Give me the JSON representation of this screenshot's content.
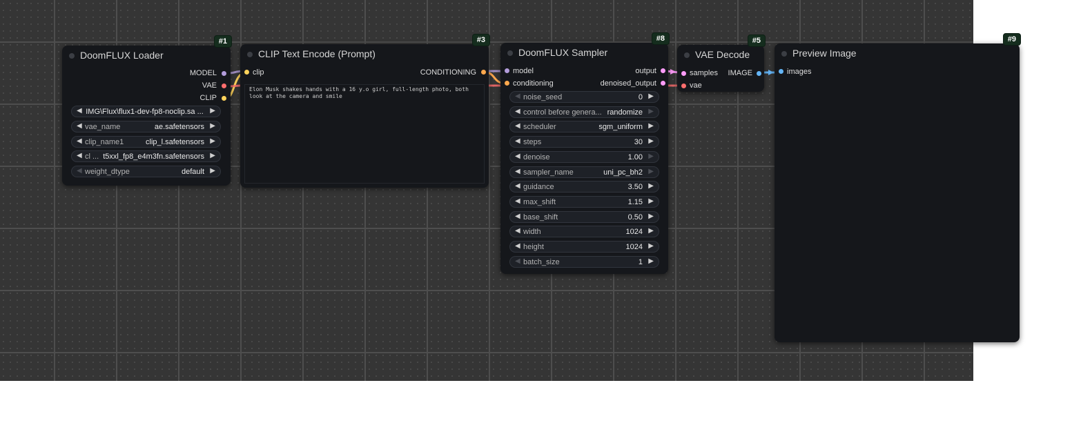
{
  "colors": {
    "model": "#b39ddb",
    "vae": "#ff6e6e",
    "clip": "#ffd35b",
    "conditioning": "#ffa84d",
    "latent": "#ff9cf9",
    "image": "#64b5f6",
    "badge": "#152d1e",
    "node_bg": "#15171b"
  },
  "loader": {
    "title": "DoomFLUX Loader",
    "badge": "#1",
    "outputs": [
      "MODEL",
      "VAE",
      "CLIP"
    ],
    "widgets": [
      {
        "label": "",
        "value": "IMG\\Flux\\flux1-dev-fp8-noclip.sa ...",
        "left_dim": false,
        "right_dim": false
      },
      {
        "label": "vae_name",
        "value": "ae.safetensors",
        "left_dim": false,
        "right_dim": false
      },
      {
        "label": "clip_name1",
        "value": "clip_l.safetensors",
        "left_dim": false,
        "right_dim": false
      },
      {
        "label": "cl ...",
        "value": "t5xxl_fp8_e4m3fn.safetensors",
        "left_dim": false,
        "right_dim": false
      },
      {
        "label": "weight_dtype",
        "value": "default",
        "left_dim": true,
        "right_dim": false
      }
    ]
  },
  "clip_encode": {
    "title": "CLIP Text Encode (Prompt)",
    "badge": "#3",
    "input": "clip",
    "output": "CONDITIONING",
    "prompt": "Elon Musk shakes hands with a 16 y.o girl, full-length photo, both look at the camera and smile"
  },
  "sampler": {
    "title": "DoomFLUX Sampler",
    "badge": "#8",
    "inputs": [
      "model",
      "conditioning"
    ],
    "outputs": [
      "output",
      "denoised_output"
    ],
    "widgets": [
      {
        "label": "noise_seed",
        "value": "0",
        "left_dim": true,
        "right_dim": false
      },
      {
        "label": "control before genera...",
        "value": "randomize",
        "left_dim": false,
        "right_dim": true
      },
      {
        "label": "scheduler",
        "value": "sgm_uniform",
        "left_dim": false,
        "right_dim": false
      },
      {
        "label": "steps",
        "value": "30",
        "left_dim": false,
        "right_dim": false
      },
      {
        "label": "denoise",
        "value": "1.00",
        "left_dim": false,
        "right_dim": true
      },
      {
        "label": "sampler_name",
        "value": "uni_pc_bh2",
        "left_dim": false,
        "right_dim": true
      },
      {
        "label": "guidance",
        "value": "3.50",
        "left_dim": false,
        "right_dim": false
      },
      {
        "label": "max_shift",
        "value": "1.15",
        "left_dim": false,
        "right_dim": false
      },
      {
        "label": "base_shift",
        "value": "0.50",
        "left_dim": false,
        "right_dim": false
      },
      {
        "label": "width",
        "value": "1024",
        "left_dim": false,
        "right_dim": false
      },
      {
        "label": "height",
        "value": "1024",
        "left_dim": false,
        "right_dim": false
      },
      {
        "label": "batch_size",
        "value": "1",
        "left_dim": true,
        "right_dim": false
      }
    ]
  },
  "vae_decode": {
    "title": "VAE Decode",
    "badge": "#5",
    "inputs": [
      "samples",
      "vae"
    ],
    "output": "IMAGE"
  },
  "preview": {
    "title": "Preview Image",
    "badge": "#9",
    "input": "images"
  }
}
